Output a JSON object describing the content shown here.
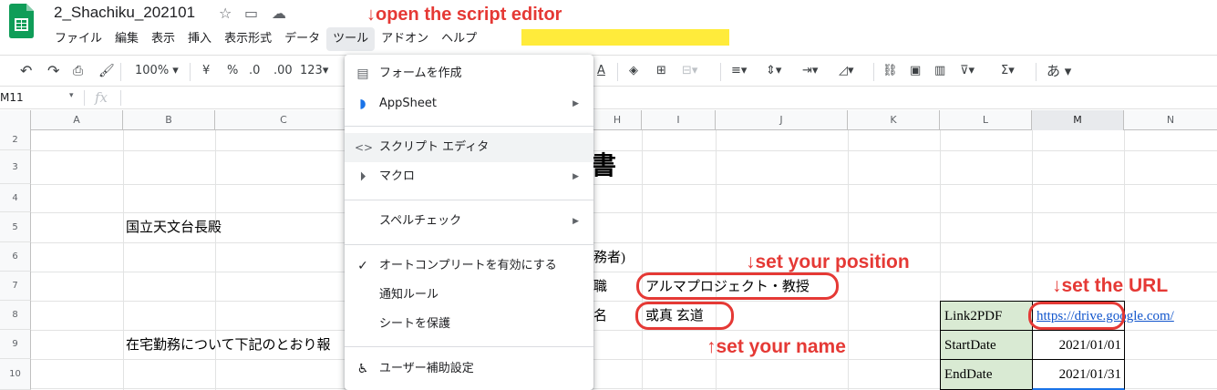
{
  "app": {
    "title": "2_Shachiku_202101",
    "brand_color": "#0f9d58"
  },
  "menu": [
    "ファイル",
    "編集",
    "表示",
    "挿入",
    "表示形式",
    "データ",
    "ツール",
    "アドオン",
    "ヘルプ"
  ],
  "annotations": {
    "open_editor": "↓open the script editor",
    "position": "↓set your position",
    "url": "↓set the URL",
    "name": "↑set your name",
    "accent": "#e53935"
  },
  "toolbar": {
    "zoom": "100%",
    "currency": "¥",
    "percent": "%",
    "decimal_less": ".0",
    "decimal_more": ".00",
    "format": "123",
    "input_tool": "あ"
  },
  "formula_bar": {
    "name_box": "M11",
    "fx": "fx"
  },
  "columns": [
    "A",
    "B",
    "C",
    "H",
    "I",
    "J",
    "K",
    "L",
    "M",
    "N"
  ],
  "rows": [
    "2",
    "3",
    "4",
    "5",
    "6",
    "7",
    "8",
    "9",
    "10"
  ],
  "cells": {
    "b5": "国立天文台長殿",
    "b9": "在宅勤務について下記のとおり報",
    "h6": "務者)",
    "h7": "職",
    "h8": "名",
    "i7": "アルマプロジェクト・教授",
    "i8": "或真 玄道",
    "l8": "Link2PDF",
    "m8": "https://drive.google.com/",
    "l9": "StartDate",
    "m9": "2021/01/01",
    "l10": "EndDate",
    "m10": "2021/01/31",
    "g3_partial": "書"
  },
  "dropdown": {
    "items": [
      {
        "label": "フォームを作成",
        "icon": "form-icon"
      },
      {
        "label": "AppSheet",
        "icon": "appsheet-icon",
        "submenu": true
      },
      {
        "label": "スクリプト エディタ",
        "icon": "code-icon",
        "highlighted": true
      },
      {
        "label": "マクロ",
        "icon": "play-icon",
        "submenu": true
      },
      {
        "label": "スペルチェック",
        "submenu": true
      },
      {
        "label": "オートコンプリートを有効にする",
        "checked": true
      },
      {
        "label": "通知ルール"
      },
      {
        "label": "シートを保護"
      },
      {
        "label": "ユーザー補助設定",
        "icon": "accessibility-icon"
      }
    ]
  }
}
